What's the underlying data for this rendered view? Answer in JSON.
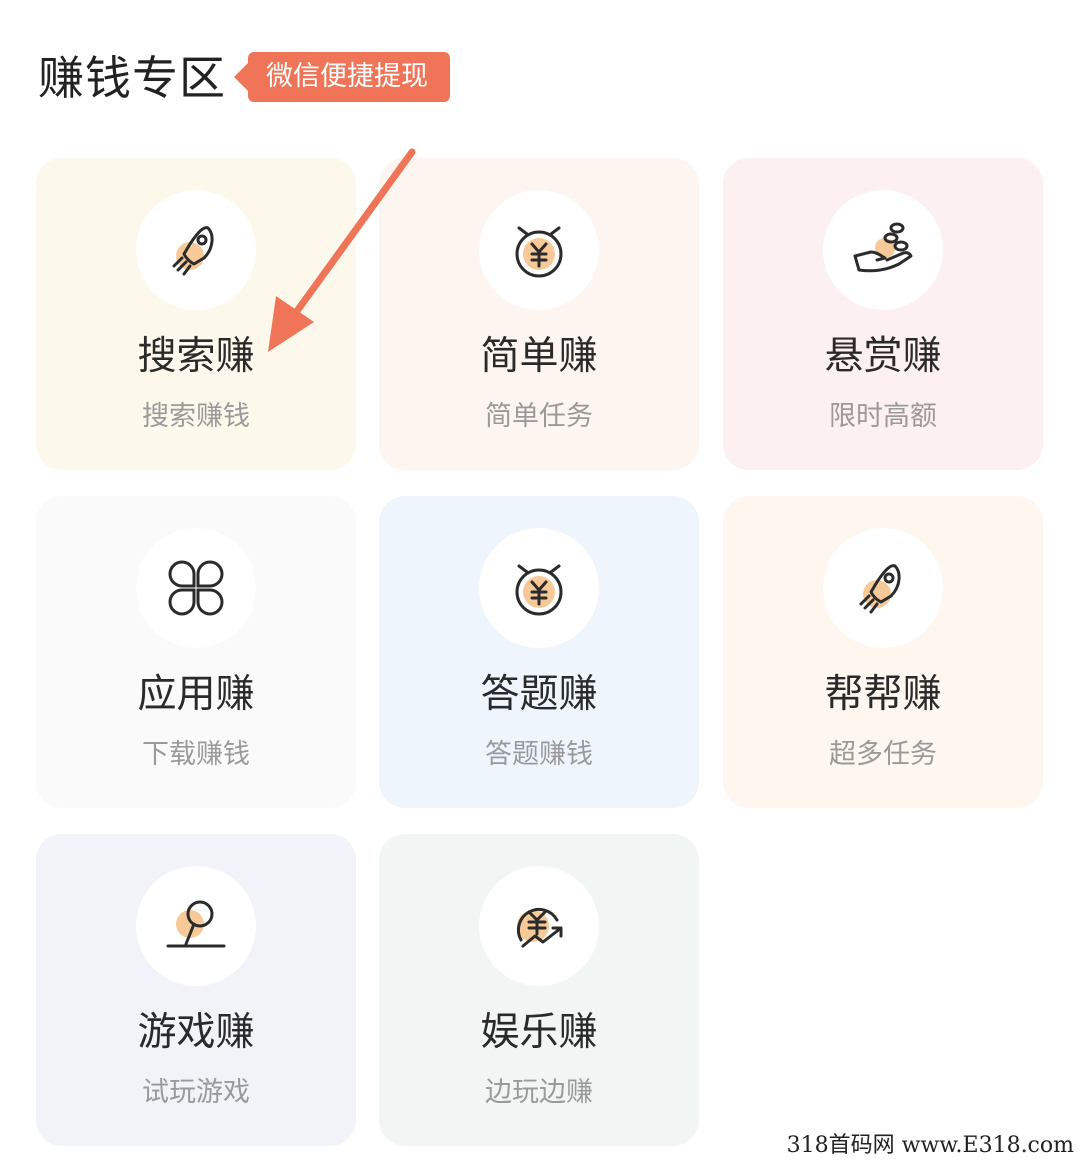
{
  "section": {
    "title": "赚钱专区",
    "badge": "微信便捷提现"
  },
  "cards": [
    {
      "title": "搜索赚",
      "subtitle": "搜索赚钱",
      "icon": "rocket-icon",
      "bg": "#fdf8ec"
    },
    {
      "title": "简单赚",
      "subtitle": "简单任务",
      "icon": "yuan-clock-icon",
      "bg": "#fdf6f0"
    },
    {
      "title": "悬赏赚",
      "subtitle": "限时高额",
      "icon": "coins-hand-icon",
      "bg": "#fdf0f1"
    },
    {
      "title": "应用赚",
      "subtitle": "下载赚钱",
      "icon": "app-grid-icon",
      "bg": "#fafafa"
    },
    {
      "title": "答题赚",
      "subtitle": "答题赚钱",
      "icon": "yuan-clock-icon",
      "bg": "#eef5fd"
    },
    {
      "title": "帮帮赚",
      "subtitle": "超多任务",
      "icon": "rocket-icon",
      "bg": "#fdf7f0"
    },
    {
      "title": "游戏赚",
      "subtitle": "试玩游戏",
      "icon": "joystick-icon",
      "bg": "#f1f3f8"
    },
    {
      "title": "娱乐赚",
      "subtitle": "边玩边赚",
      "icon": "yuan-growth-icon",
      "bg": "#f1f6f5"
    }
  ],
  "colors": {
    "accent": "#ef7458",
    "icon_fill": "#f7c998",
    "icon_stroke": "#2b2b2b"
  },
  "watermark": "318首码网 www.E318.com"
}
